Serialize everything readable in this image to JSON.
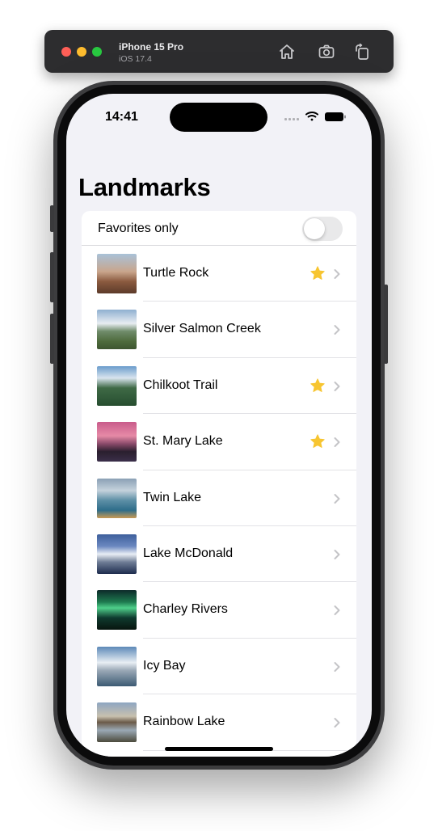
{
  "simulator": {
    "device_name": "iPhone 15 Pro",
    "os_version": "iOS 17.4",
    "toolbar_icons": [
      "home-icon",
      "screenshot-icon",
      "rotate-icon"
    ]
  },
  "status_bar": {
    "time": "14:41",
    "icons": [
      "signal-icon",
      "wifi-icon",
      "battery-icon"
    ]
  },
  "nav": {
    "title": "Landmarks"
  },
  "favorites_toggle": {
    "label": "Favorites only",
    "on": false
  },
  "landmarks": [
    {
      "name": "Turtle Rock",
      "favorite": true
    },
    {
      "name": "Silver Salmon Creek",
      "favorite": false
    },
    {
      "name": "Chilkoot Trail",
      "favorite": true
    },
    {
      "name": "St. Mary Lake",
      "favorite": true
    },
    {
      "name": "Twin Lake",
      "favorite": false
    },
    {
      "name": "Lake McDonald",
      "favorite": false
    },
    {
      "name": "Charley Rivers",
      "favorite": false
    },
    {
      "name": "Icy Bay",
      "favorite": false
    },
    {
      "name": "Rainbow Lake",
      "favorite": false
    }
  ],
  "colors": {
    "star": "#f7c531",
    "chevron": "#c4c4c7",
    "background": "#f2f2f7",
    "toggle_off": "#e9e9ea"
  }
}
